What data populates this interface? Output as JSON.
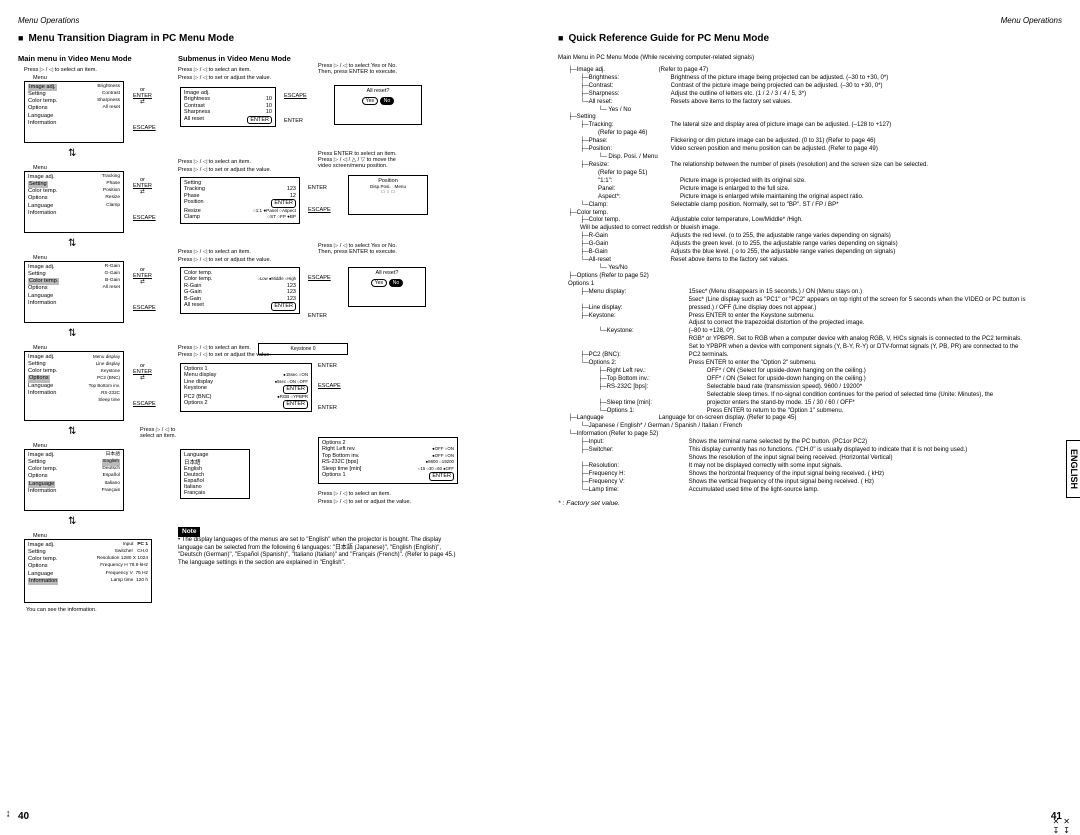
{
  "header": "Menu Operations",
  "left": {
    "title": "Menu Transition Diagram in PC Menu Mode",
    "sub_a": "Main menu in Video Menu Mode",
    "sub_b": "Submenus in Video Menu Mode",
    "press_select": "Press ▷ / ◁ to select an item.",
    "press_setadj": "Press ▷ / ◁ to set or adjust the value.",
    "press_yesno": "Press ▷ / ◁ to select Yes or No.\nThen, press ENTER to execute.",
    "press_enter_sel": "Press ENTER to select an item.\nPress ▷ / ◁ / △ / ▽ to move the\nvideo screen/menu position.",
    "or": "or",
    "enter": "ENTER",
    "escape": "ESCAPE",
    "keystone_row": "Keystone       0",
    "menu_labels": [
      "Image adj.",
      "Setting",
      "Color temp.",
      "Options",
      "Language",
      "Information"
    ],
    "image_items": [
      "Brightness",
      "Contrast",
      "Sharpness",
      "All reset"
    ],
    "setting_items": [
      "Tracking",
      "Phase",
      "Position",
      "Resize",
      "Clamp"
    ],
    "color_items": [
      "R-Gain",
      "G-Gain",
      "B-Gain",
      "All reset"
    ],
    "options_items": [
      "Menu display",
      "Line display",
      "Keystone",
      "PC2 (BNC)",
      "Top Bottom inv.",
      "RS-232C",
      "Sleep time"
    ],
    "lang_items": [
      "日本語",
      "English",
      "Deutsch",
      "Español",
      "Italiano",
      "Français"
    ],
    "info_items": [
      [
        "Input",
        "PC 1"
      ],
      [
        "Switcher",
        "CH.0"
      ],
      [
        "Resolution",
        "1280 X 1024"
      ],
      [
        "Frequency H",
        "79.9 kHz"
      ],
      [
        "Frequency V",
        "75 Hz"
      ],
      [
        "Lamp time",
        "120 h"
      ]
    ],
    "sub_image": [
      [
        "Brightness",
        "10"
      ],
      [
        "Contrast",
        "10"
      ],
      [
        "Sharpness",
        "10"
      ],
      [
        "All reset",
        ""
      ]
    ],
    "sub_setting": [
      [
        "Tracking",
        "123"
      ],
      [
        "Phase",
        "12"
      ],
      [
        "Position",
        "ENTER"
      ],
      [
        "Resize",
        "○1:1 ●Panel ○Aspect"
      ],
      [
        "Clamp",
        "○ST ○FP ●BP"
      ]
    ],
    "sub_color": [
      [
        "Color temp.",
        "○Low ●Middle ○High"
      ],
      [
        "R-Gain",
        "123"
      ],
      [
        "G-Gain",
        "123"
      ],
      [
        "B-Gain",
        "123"
      ],
      [
        "All reset",
        "ENTER"
      ]
    ],
    "sub_opt1": [
      [
        "Menu display",
        "●15sec ○ON"
      ],
      [
        "Line display",
        "●5sec ○ON ○OFF"
      ],
      [
        "Keystone",
        "ENTER"
      ],
      [
        "PC2 (BNC)",
        "●RGB ○YPBPR"
      ],
      [
        "Options 2",
        "ENTER"
      ]
    ],
    "sub_opt2_head": "Options 2",
    "sub_opt2": [
      [
        "Right Left rev.",
        "●OFF ○ON"
      ],
      [
        "Top Bottom inv.",
        "●OFF ○ON"
      ],
      [
        "RS-232C [bps]",
        "●9600 ○19200"
      ],
      [
        "Sleep time [min]",
        "○15 ○30 ○60 ●OFF"
      ],
      [
        "Options 1",
        "ENTER"
      ]
    ],
    "sub_lang_head": "Language",
    "allreset_popup": [
      "All reset?",
      "Yes",
      "No"
    ],
    "position_popup": [
      "Position",
      "Disp.Posi.",
      "Menu"
    ],
    "select_item": "Press ▷ / ◁ to\nselect an item.",
    "note_label": "Note",
    "note_text": "• The display languages of the menus are set to \"English\" when the projector is bought. The display language can be selected from the following 6 languages: \"日本語 (Japanese)\", \"English (English)\", \"Deutsch (German)\", \"Español (Spanish)\", \"Italiano (Italian)\" and \"Français (French)\". (Refer to page 45.)\nThe language settings in the section are explained in \"English\".",
    "info_note": "You can see the information.",
    "page": "40"
  },
  "right": {
    "title": "Quick Reference Guide for PC Menu Mode",
    "intro": "Main Menu in PC Menu Mode (While receiving computer-related signals)",
    "image_adj": "Image adj.",
    "image_ref": "(Refer to page 47)",
    "brightness": "Brightness of the picture image being projected can be adjusted. (–30 to +30, 0*)",
    "contrast": "Contrast of the picture image being projected can be adjusted. (–30 to +30, 0*)",
    "sharpness": "Adjust the outline of letters etc. (1 / 2 / 3 / 4 / 5, 3*)",
    "allreset": "Resets above items to the factory set values.",
    "yesno": "└─ Yes / No",
    "setting": "Setting",
    "tracking": "The lateral size and display area of picture image can be adjusted. (–128 to +127)",
    "tracking_ref": "(Refer to page 46)",
    "phase": "Flickering or dim picture image can be adjusted. (0 to 31)      (Refer to page 46)",
    "position": "Video screen position and menu position can be adjusted.      (Refer to page 49)",
    "disp_posi": "└─ Disp. Posi. / Menu",
    "resize": "The relationship between the number of pixels (resolution) and the screen size can be selected.",
    "resize_ref": "(Refer to page 51)",
    "r11": "\"1:1\":",
    "r11_d": "Picture image is projected with its original size.",
    "panel": "Panel:",
    "panel_d": "Picture image is enlarged to the full size.",
    "aspect": "Aspect*:",
    "aspect_d": "Picture image is enlarged while maintaining the original aspect ratio.",
    "clamp": "Selectable clamp position. Normally, set to \"BP\". ST / FP / BP*",
    "colortemp": "Color temp.",
    "ct_adj": "Adjustable color temperature, Low/Middle* /High.\nWill be adjusted to correct reddish or blueish image.",
    "rgain": "Adjusts the red level. (o to 255, the adjustable range varies depending on signals)",
    "ggain": "Adjusts the green level. (o to 255, the adjustable range varies depending on signals)",
    "bgain": "Adjusts the blue level. ( o to 255, the adjustable range varies depending on signals)",
    "ct_reset": "Reset above items to the factory set values.",
    "ct_yn": "└─ Yes/No",
    "options": "Options      (Refer to page 52)",
    "opt1": "Options 1",
    "menu_disp": "15sec* (Menu disappears in 15 seconds.) / ON (Menu stays on.)",
    "line_disp": "5sec* (Line display such as \"PC1\" or \"PC2\" appears on top right of the screen for 5 seconds when the VIDEO or PC button is pressed.) / OFF (Line display does not appear.)",
    "keystone": "Press ENTER to enter the Keystone submenu.",
    "ks_sub": "Adjust to correct the trapezoidal distortion of the projected image.\n(–80 to +128, 0*)",
    "pc2": "RGB* or YPBPR. Set to RGB when a computer device with analog RGB, V, H/Cs signals is connected to the PC2 terminals. Set to YPBPR when a device with component signals (Y, B-Y, R-Y) or DTV-format signals (Y, PB, PR) are connected to the PC2 terminals.",
    "opt2": "Press ENTER to enter the \"Option 2\" submenu.",
    "rl_rev": "OFF* / ON (Select for upside-down hanging on the ceiling.)",
    "tb_inv": "OFF* / ON (Select for upside-down hanging on the ceiling.)",
    "rs232": "Selectable baud rate (transmission speed). 9600 / 19200*",
    "sleep": "Selectable sleep times. If no-signal condition continues for the period of selected time (Unite: Minutes), the projector enters the stand-by mode. 15 / 30 / 60 / OFF*",
    "opt1_back": "Press ENTER to return to the \"Option 1\" submenu.",
    "language": "Language for on-screen display.      (Refer to page 45)",
    "lang_list": "└─Japanese / English* / German / Spanish / Italian / French",
    "information": "Information      (Refer to page 52)",
    "input": "Shows the terminal name selected by the PC button. (PC1or PC2)",
    "switcher": "This display currently has no functions. (\"CH.0\" is usually displayed to indicate that it is not being used.)",
    "resolution": "Shows the resolution of the input signal being received. (Horizontal     Vertical)\nIt may not be displayed correctly with some input signals.",
    "freqh": "Shows the horizontal frequency of the input signal being received. (     kHz)",
    "freqv": "Shows the vertical frequency of the input signal being received. (     Hz)",
    "lamp": "Accumulated used time of the light-source lamp.",
    "factory": "* : Factory set value.",
    "english_tab": "ENGLISH",
    "page": "41"
  }
}
